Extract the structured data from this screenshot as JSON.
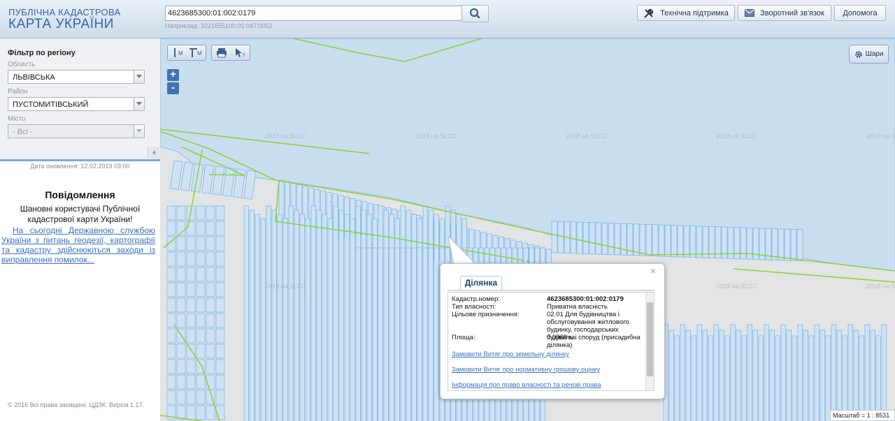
{
  "header": {
    "logo_line1": "ПУБЛІЧНА КАДАСТРОВА",
    "logo_line2": "КАРТА УКРАЇНИ",
    "search_value": "4623685300:01:002:0179",
    "search_hint": "Наприклад: 3221655100:01:047:0052",
    "buttons": {
      "support": "Технічна підтримка",
      "feedback": "Зворотний зв'язок",
      "help": "Допомога"
    }
  },
  "sidebar": {
    "filter_title": "Фільтр по регіону",
    "oblast_label": "Область",
    "oblast_value": "ЛЬВІВСЬКА",
    "rayon_label": "Район",
    "rayon_value": "ПУСТОМИТІВСЬКИЙ",
    "city_label": "Місто",
    "city_value": "- Всі -",
    "update_date": "Дата оновлення: 12.02.2019 03:00",
    "news_title": "Повідомлення",
    "news_greeting": "Шановні користувачі Публічної кадастрової карти України!",
    "news_link": "На сьогодні Державною службою України з питань геодезії, картографії та кадастру здійснюються заходи із виправлення помилок...",
    "copyright": "© 2016 Всі права захищені. ЦДЗК. Версія 1.17."
  },
  "map": {
    "toolbar_labels": {
      "measure_length": "М",
      "measure_area": "М"
    },
    "zoom_in": "+",
    "zoom_out": "-",
    "layers_label": "Шари",
    "scale": "Масштаб = 1 : 8531",
    "watermark": "2018 ua.SLCC",
    "colors": {
      "water": "#c9dff0",
      "parcel_stroke": "#7fb6e8",
      "boundary": "#8ed13e",
      "land": "#e3e4e6"
    },
    "icons": [
      "ruler-icon",
      "area-ruler-icon",
      "print-icon",
      "identify-cursor-icon",
      "gear-icon",
      "search-icon",
      "tools-icon",
      "envelope-icon"
    ]
  },
  "popup": {
    "tab": "Ділянка",
    "rows": [
      {
        "label": "Кадастр.номер:",
        "value": "4623685300:01:002:0179"
      },
      {
        "label": "Тип власності:",
        "value": "Приватна власність"
      },
      {
        "label": "Цільове призначення:",
        "value": "02.01 Для будівництва і обслуговування житлового будинку, господарських будівель і споруд (присадибна ділянка)"
      },
      {
        "label": "Площа:",
        "value": "0.0968 га"
      }
    ],
    "links": [
      "Замовити Витяг про земельну ділянку",
      "Замовити Витяг про нормативну грошову оцінку",
      "Інформація про право власності та речові права"
    ]
  }
}
